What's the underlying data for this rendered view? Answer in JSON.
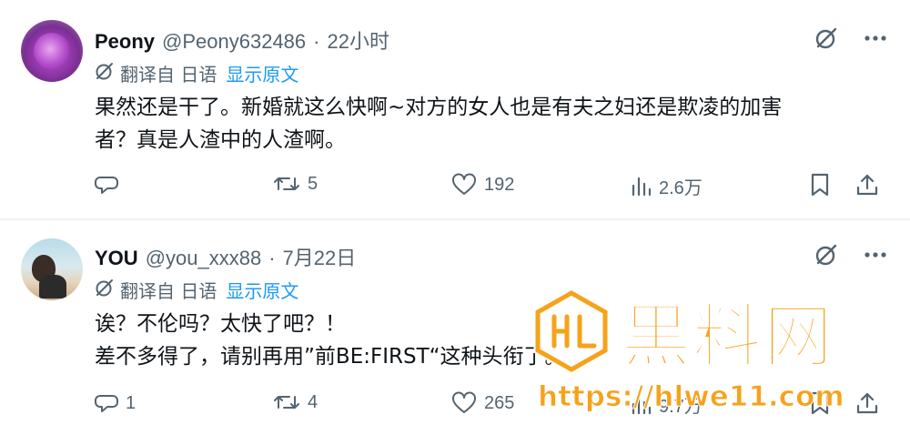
{
  "posts": [
    {
      "name": "Peony",
      "handle": "@Peony632486",
      "separator": "·",
      "time": "22小时",
      "translate": {
        "label": "翻译自 日语",
        "show_original": "显示原文"
      },
      "lines": [
        "果然还是干了。新婚就这么快啊~对方的女人也是有夫之妇还是欺凌的加害",
        "者？真是人渣中的人渣啊。"
      ],
      "stats": {
        "replies": "",
        "reposts": "5",
        "likes": "192",
        "views": "2.6万"
      }
    },
    {
      "name": "YOU",
      "handle": "@you_xxx88",
      "separator": "·",
      "time": "7月22日",
      "translate": {
        "label": "翻译自 日语",
        "show_original": "显示原文"
      },
      "lines": [
        "诶？不伦吗？太快了吧？！",
        "差不多得了，请别再用”前BE:FIRST“这种头衔了。"
      ],
      "stats": {
        "replies": "1",
        "reposts": "4",
        "likes": "265",
        "views": "9.7万"
      }
    }
  ],
  "icons": {
    "grok": "grok-icon",
    "more": "more-icon",
    "translate": "translate-icon",
    "reply": "reply-icon",
    "repost": "repost-icon",
    "like": "heart-icon",
    "views": "views-icon",
    "bookmark": "bookmark-icon",
    "share": "share-icon"
  },
  "watermark": {
    "title": "黑料网",
    "url": "https://hlwe11.com"
  },
  "colors": {
    "text": "#0f1419",
    "secondary": "#536471",
    "link": "#1d9bf0",
    "watermark": "#f6a21a"
  }
}
